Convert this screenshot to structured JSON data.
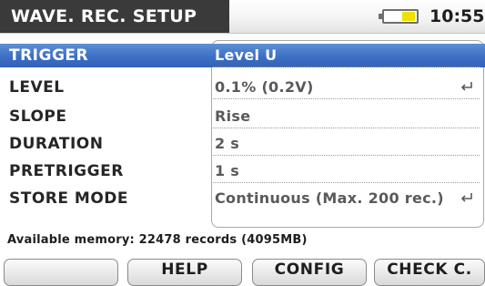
{
  "header": {
    "title": "WAVE. REC. SETUP",
    "time": "10:55",
    "battery_level": 0.45,
    "battery_color": "#f0e000"
  },
  "settings": [
    {
      "label": "TRIGGER",
      "value": "Level U",
      "selected": true,
      "has_enter": false
    },
    {
      "label": "LEVEL",
      "value": "0.1% (0.2V)",
      "selected": false,
      "has_enter": true
    },
    {
      "label": "SLOPE",
      "value": "Rise",
      "selected": false,
      "has_enter": false
    },
    {
      "label": "DURATION",
      "value": "2 s",
      "selected": false,
      "has_enter": false
    },
    {
      "label": "PRETRIGGER",
      "value": "1 s",
      "selected": false,
      "has_enter": false
    },
    {
      "label": "STORE MODE",
      "value": "Continuous (Max. 200 rec.)",
      "selected": false,
      "has_enter": true
    }
  ],
  "memory_text": "Available memory: 22478 records (4095MB)",
  "function_keys": [
    "",
    "HELP",
    "CONFIG",
    "CHECK C."
  ],
  "colors": {
    "selection": "#3d6fc4",
    "title_bar": "#3a3a3a"
  },
  "icons": {
    "enter": "enter-return-icon",
    "battery": "battery-icon"
  }
}
